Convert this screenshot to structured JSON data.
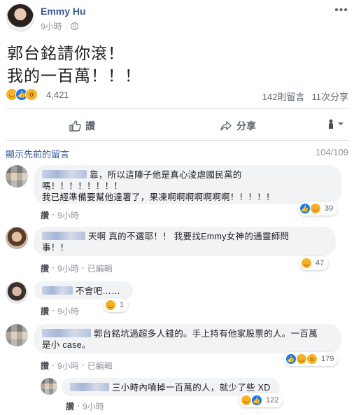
{
  "post": {
    "author": "Emmy Hu",
    "time": "9小時",
    "text_line1": "郭台銘請你滾！",
    "text_line2": "我的一百萬！！！",
    "reaction_count": "4,421",
    "comments_stat": "142則留言",
    "shares_stat": "11次分享"
  },
  "actions": {
    "like_label": "讚",
    "share_label": "分享"
  },
  "comments_section": {
    "view_previous": "顯示先前的留言",
    "count": "104/109"
  },
  "comments": [
    {
      "line1": "靠，所以這陣子他是真心淩虐國民黨的",
      "line2": "嗎！！！！！！！！",
      "line3": "我已經準備要幫他達署了，果凍啊啊啊啊啊啊啊！！！！！",
      "like": "讚",
      "time": "9小時",
      "reactions": "39"
    },
    {
      "line1": "天啊 真的不選耶！！ 我要找Emmy女神的通靈師問",
      "line2": "事！！",
      "like": "讚",
      "time": "9小時",
      "edited": "已編輯",
      "reactions": "47"
    },
    {
      "line1": "不會吧……",
      "like": "讚",
      "time": "9小時",
      "reactions": "1"
    },
    {
      "line1": "郭台銘坑過超多人錢的。手上持有他家股票的人。一百萬",
      "line2": "是小 case。",
      "like": "讚",
      "time": "9小時",
      "edited": "已編輯",
      "reactions": "179"
    },
    {
      "line1": "三小時內噴掉一百萬的人，就少了些 XD",
      "like": "讚",
      "time": "9小時",
      "reactions": "122"
    }
  ],
  "separator": "·",
  "icons": {
    "haha": "haha-icon",
    "like": "like-icon",
    "wow": "wow-icon",
    "globe": "globe-icon",
    "share": "share-arrow-icon"
  },
  "colors": {
    "link": "#385898",
    "like_blue": "#1877f2",
    "emoji_yellow": "#f7b125",
    "bubble": "#f2f3f5"
  }
}
